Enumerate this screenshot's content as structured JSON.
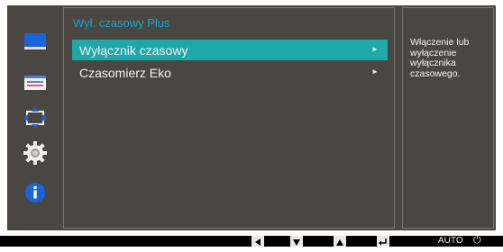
{
  "sidebar": {
    "icons": [
      "monitor-icon",
      "picture-adjust-icon",
      "screen-position-icon",
      "gear-icon",
      "info-icon"
    ]
  },
  "menu": {
    "title": "Wył. czasowy Plus",
    "items": [
      {
        "label": "Wyłącznik czasowy",
        "arrow": "►",
        "selected": true
      },
      {
        "label": "Czasomierz Eko",
        "arrow": "►",
        "selected": false
      }
    ]
  },
  "description": {
    "text": "Włączenie lub wyłączenie wyłącznika czasowego."
  },
  "bottom_bar": {
    "keys": [
      "left-arrow-icon",
      "down-arrow-icon",
      "up-arrow-icon",
      "enter-icon"
    ],
    "auto_label": "AUTO",
    "power_symbol": "⏻"
  },
  "colors": {
    "accent": "#1fa7aa",
    "title": "#1aa4c9",
    "panel": "#4a4642"
  }
}
